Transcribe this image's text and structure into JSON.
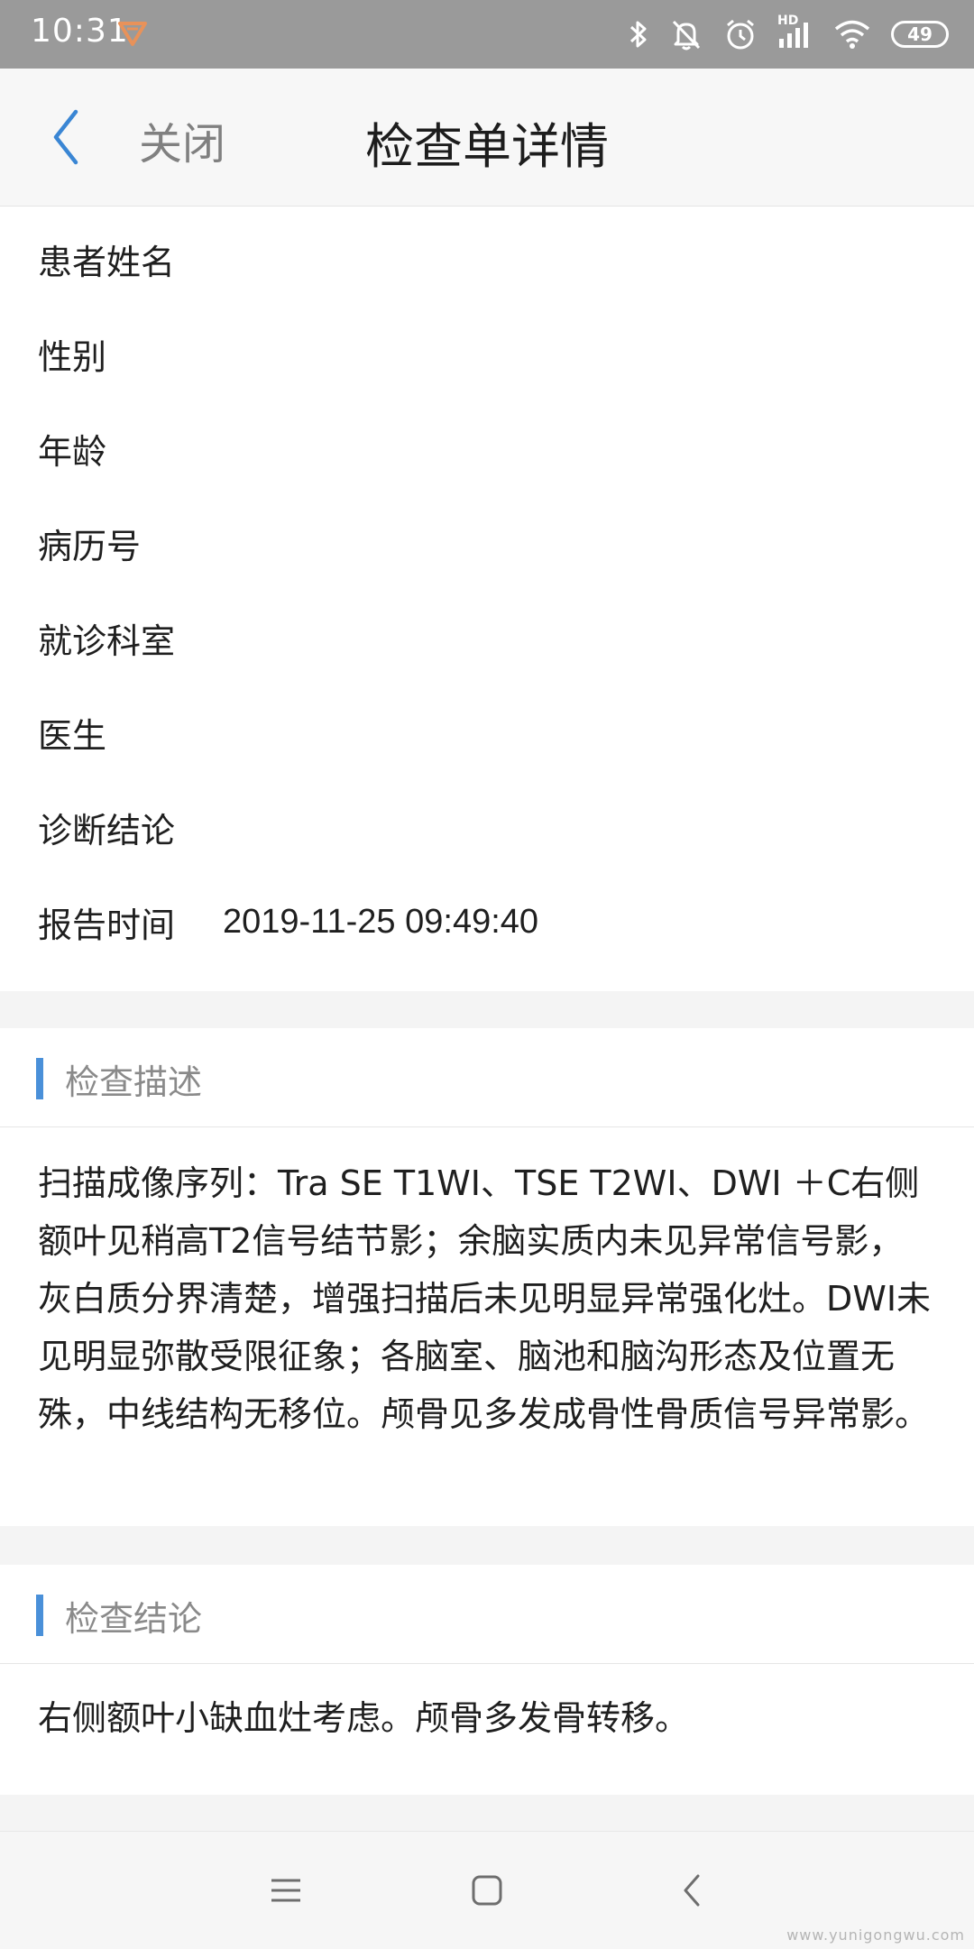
{
  "status_bar": {
    "time": "10:31",
    "battery": "49",
    "icons": [
      "app-notification-icon",
      "bluetooth-icon",
      "mute-icon",
      "alarm-icon",
      "hd-signal-icon",
      "wifi-icon",
      "battery-icon"
    ],
    "hd_label": "HD"
  },
  "header": {
    "close_label": "关闭",
    "title": "检查单详情",
    "back_icon": "chevron-left-icon"
  },
  "patient_info": [
    {
      "label": "患者姓名",
      "value": ""
    },
    {
      "label": "性别",
      "value": ""
    },
    {
      "label": "年龄",
      "value": ""
    },
    {
      "label": "病历号",
      "value": ""
    },
    {
      "label": "就诊科室",
      "value": ""
    },
    {
      "label": "医生",
      "value": ""
    },
    {
      "label": "诊断结论",
      "value": ""
    },
    {
      "label": "报告时间",
      "value": "2019-11-25 09:49:40"
    }
  ],
  "sections": {
    "description": {
      "title": "检查描述",
      "text": "扫描成像序列：Tra SE T1WI、TSE T2WI、DWI ＋C右侧额叶见稍高T2信号结节影；余脑实质内未见异常信号影，灰白质分界清楚，增强扫描后未见明显异常强化灶。DWI未见明显弥散受限征象；各脑室、脑池和脑沟形态及位置无殊，中线结构无移位。颅骨见多发成骨性骨质信号异常影。"
    },
    "conclusion": {
      "title": "检查结论",
      "text": "右侧额叶小缺血灶考虑。颅骨多发骨转移。"
    }
  },
  "colors": {
    "status_bar": "#9a9a9a",
    "accent": "#4a90d9",
    "section_title": "#8a8a8a",
    "background": "#f4f4f4"
  },
  "system_nav": {
    "icons": [
      "menu-icon",
      "home-icon",
      "back-icon"
    ]
  },
  "watermark": "www.yunigongwu.com"
}
